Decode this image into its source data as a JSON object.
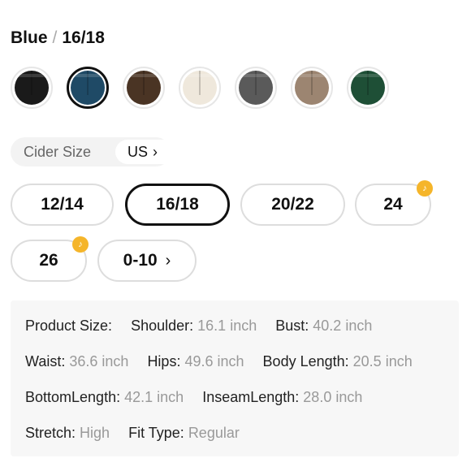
{
  "header": {
    "color_name": "Blue",
    "separator": "/",
    "size": "16/18"
  },
  "swatches": [
    {
      "name": "black",
      "color": "#1a1a1a",
      "selected": false
    },
    {
      "name": "blue",
      "color": "#1f4a66",
      "selected": true
    },
    {
      "name": "brown",
      "color": "#4a3424",
      "selected": false
    },
    {
      "name": "cream",
      "color": "#efe8dc",
      "selected": false
    },
    {
      "name": "grey",
      "color": "#5a5a5a",
      "selected": false
    },
    {
      "name": "taupe",
      "color": "#9c8571",
      "selected": false
    },
    {
      "name": "green",
      "color": "#1e4f36",
      "selected": false
    }
  ],
  "size_system": {
    "label": "Cider Size",
    "region": "US",
    "chevron": "chevron-right-icon"
  },
  "sizes": [
    {
      "label": "12/14",
      "selected": false,
      "badge": false
    },
    {
      "label": "16/18",
      "selected": true,
      "badge": false
    },
    {
      "label": "20/22",
      "selected": false,
      "badge": false
    },
    {
      "label": "24",
      "selected": false,
      "badge": true
    },
    {
      "label": "26",
      "selected": false,
      "badge": true
    },
    {
      "label": "0-10",
      "selected": false,
      "badge": false,
      "chevron": "chevron-right-icon"
    }
  ],
  "badge_color": "#f5b52a",
  "details": {
    "product_size_label": "Product Size:",
    "shoulder_label": "Shoulder:",
    "shoulder_value": "16.1 inch",
    "bust_label": "Bust:",
    "bust_value": "40.2 inch",
    "waist_label": "Waist:",
    "waist_value": "36.6 inch",
    "hips_label": "Hips:",
    "hips_value": "49.6 inch",
    "body_length_label": "Body Length:",
    "body_length_value": "20.5 inch",
    "bottom_length_label": "BottomLength:",
    "bottom_length_value": "42.1 inch",
    "inseam_length_label": "InseamLength:",
    "inseam_length_value": "28.0 inch",
    "stretch_label": "Stretch:",
    "stretch_value": "High",
    "fit_type_label": "Fit Type:",
    "fit_type_value": "Regular"
  }
}
